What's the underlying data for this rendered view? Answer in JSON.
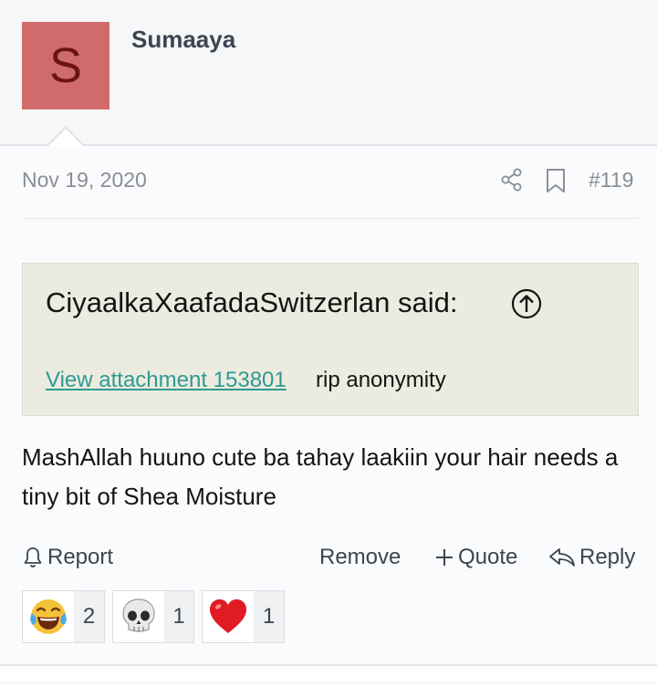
{
  "user": {
    "initial": "S",
    "name": "Sumaaya"
  },
  "post": {
    "date": "Nov 19, 2020",
    "number": "#119",
    "quote": {
      "author_said": "CiyaalkaXaafadaSwitzerlan said:",
      "attachment_link": "View attachment 153801",
      "text": "rip anonymity"
    },
    "message": "MashAllah huuno cute ba tahay laakiin your hair needs a tiny bit of Shea Moisture"
  },
  "actions": {
    "report": "Report",
    "remove": "Remove",
    "quote": "Quote",
    "reply": "Reply"
  },
  "reactions": [
    {
      "icon": "laughing-tears-icon",
      "count": "2"
    },
    {
      "icon": "skull-icon",
      "count": "1"
    },
    {
      "icon": "heart-icon",
      "count": "1"
    }
  ],
  "colors": {
    "avatar_bg": "#d16b6b",
    "link": "#2e9a92",
    "quote_bg": "#ecebdf"
  }
}
